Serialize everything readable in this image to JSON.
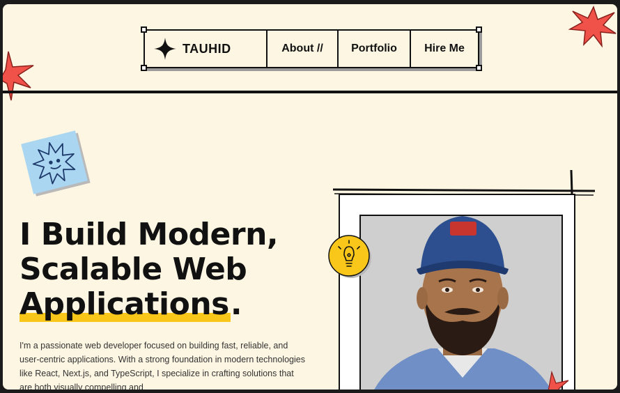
{
  "brand": {
    "name": "TAUHID",
    "logo_icon": "four-point-star-icon"
  },
  "nav": {
    "items": [
      {
        "label": "About //"
      },
      {
        "label": "Portfolio"
      },
      {
        "label": "Hire Me"
      }
    ]
  },
  "hero": {
    "title_line1": "I Build Modern,",
    "title_line2": "Scalable Web",
    "title_line3_highlight": "Applications",
    "title_line3_end": ".",
    "description": "I'm a passionate web developer focused on building fast, reliable, and user-centric applications. With a strong foundation in modern technologies like React, Next.js, and TypeScript, I specialize in crafting solutions that are both visually compelling and"
  },
  "colors": {
    "background": "#fdf6e3",
    "accent_yellow": "#f9c61a",
    "accent_red": "#f0524a",
    "sun_card": "#aad6f2",
    "ink": "#111111"
  }
}
